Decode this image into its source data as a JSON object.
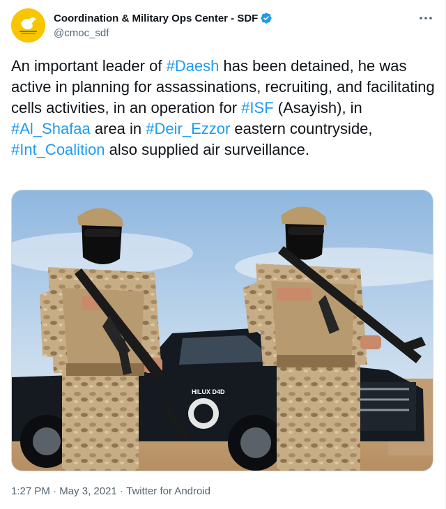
{
  "user": {
    "display_name": "Coordination & Military Ops Center - SDF",
    "handle": "@cmoc_sdf",
    "verified": true
  },
  "icons": {
    "avatar": "sdf-emblem-avatar",
    "verified": "verified-badge-icon",
    "more": "more-options-icon"
  },
  "tweet": {
    "t1": "An important leader of ",
    "h1": "#Daesh",
    "t2": " has been detained, he was active in planning for assassinations, recruiting, and facilitating cells activities, in an operation for ",
    "h2": "#ISF",
    "t3": " (Asayish), in ",
    "h3": "#Al_Shafaa",
    "t4": " area in ",
    "h4": "#Deir_Ezzor",
    "t5": " eastern countryside, ",
    "h5": "#Int_Coalition",
    "t6": " also supplied air surveillance."
  },
  "media": {
    "description_icon": "photo-two-armed-soldiers-in-front-of-pickup-truck",
    "truck_badge": "HILUX D4D"
  },
  "meta": {
    "time": "1:27 PM",
    "sep1": " · ",
    "date": "May 3, 2021",
    "sep2": " · ",
    "client": "Twitter for Android"
  },
  "colors": {
    "link": "#1d9bf0",
    "text": "#0f1419",
    "secondary": "#536471",
    "avatar_bg": "#f7c600"
  }
}
